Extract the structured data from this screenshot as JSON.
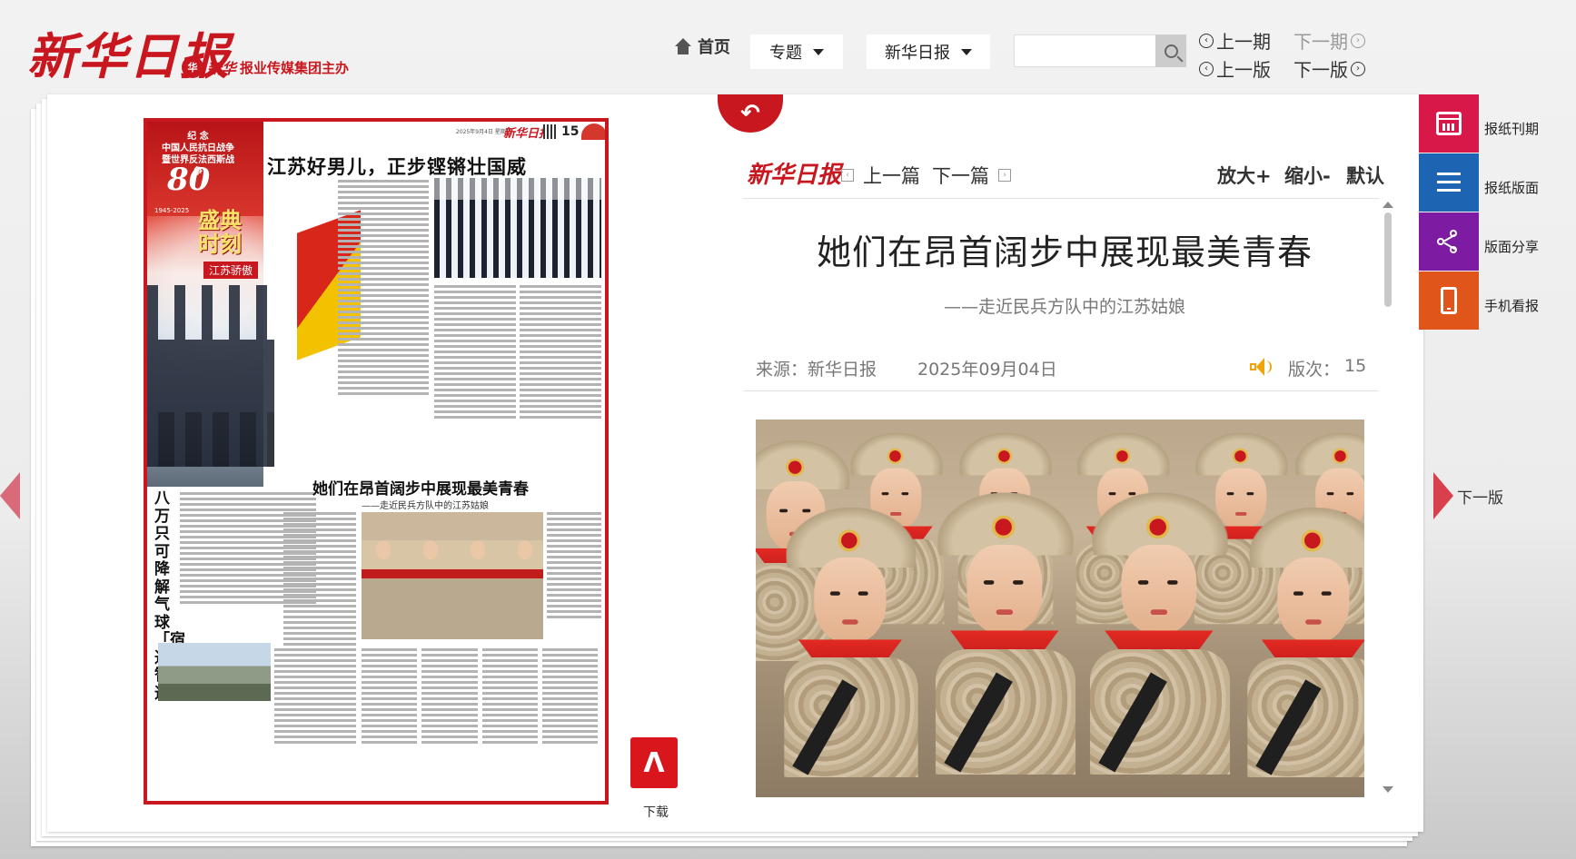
{
  "header": {
    "logo": "新华日报",
    "sub_brand": "新华",
    "host_text": "报业传媒集团主办",
    "home": "首页",
    "topic_dropdown": "专题",
    "paper_dropdown": "新华日报",
    "search_placeholder": "",
    "prev_issue": "上一期",
    "next_issue": "下一期",
    "prev_page": "上一版",
    "next_page": "下一版"
  },
  "newspaper": {
    "page_number": "15",
    "masthead": "新华日报",
    "headline": "江苏好男儿，正步铿锵壮国威",
    "badge_text": "纪 念\n中国人民抗日战争\n暨世界反法西斯战争",
    "badge_80": "80",
    "badge_years": "1945-2025",
    "shengdian": "盛典\n时刻",
    "jiangsu_tag": "江苏骄傲",
    "side_title": "八万只可降解气球「宿迁智造」",
    "headline2": "她们在昂首阔步中展现最美青春",
    "subtitle2": "——走近民兵方队中的江苏姑娘"
  },
  "download_label": "下载",
  "article": {
    "logo": "新华日报",
    "prev_article": "上一篇",
    "next_article": "下一篇",
    "zoom_in": "放大+",
    "zoom_out": "缩小-",
    "zoom_default": "默认",
    "title": "她们在昂首阔步中展现最美青春",
    "subtitle": "——走近民兵方队中的江苏姑娘",
    "source": "来源：新华日报",
    "date": "2025年09月04日",
    "page_label": "版次：",
    "page_value": "15"
  },
  "side_menu": [
    {
      "label": "报纸刊期",
      "icon": "calendar-icon",
      "color": "#d9184a"
    },
    {
      "label": "报纸版面",
      "icon": "list-icon",
      "color": "#1d65b3"
    },
    {
      "label": "版面分享",
      "icon": "share-icon",
      "color": "#7d1ca3"
    },
    {
      "label": "手机看报",
      "icon": "phone-icon",
      "color": "#e0561a"
    }
  ],
  "next_page_label": "下一版",
  "colors": {
    "brand_red": "#c8171e",
    "speaker": "#f0a30a"
  }
}
